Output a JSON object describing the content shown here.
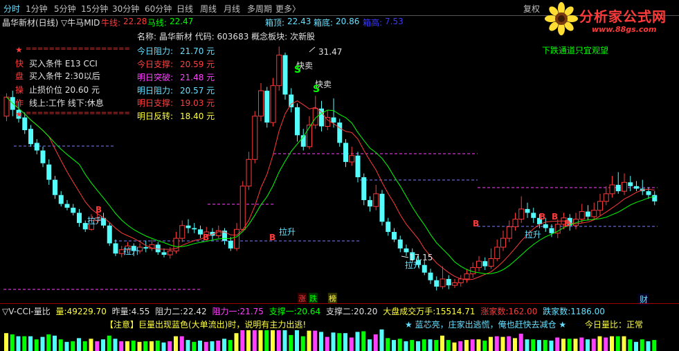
{
  "toolbar": {
    "tabs": [
      "分时",
      "1分钟",
      "5分钟",
      "15分钟",
      "30分钟",
      "60分钟",
      "日线",
      "周线",
      "月线",
      "多周期",
      "更多〉"
    ],
    "active": "分时",
    "fuquan": "复权"
  },
  "logo": {
    "title": "分析家公式网",
    "url": "www.88gs.com"
  },
  "info": {
    "stock": "晶华新材(日线)",
    "indicator": "▽牛马MID",
    "niu_label": "牛线:",
    "niu_value": "22.28",
    "ma_label": "马线:",
    "ma_value": "22.47",
    "xiangding_label": "箱顶:",
    "xiangding_value": "22.43",
    "xiangdi_label": "箱底:",
    "xiangdi_value": "20.86",
    "qiang_label": "箱高:",
    "qiang_value": "7.53"
  },
  "panel_left": {
    "rows": [
      {
        "mark": "★",
        "text": "=================="
      },
      {
        "mark": "快",
        "text": "买入条件    E13 CCI"
      },
      {
        "mark": "盘",
        "text": "买入条件    2:30以后"
      },
      {
        "mark": "操",
        "text": "止损价位    20.60 元"
      },
      {
        "mark": "作",
        "text": "线上:工作   线下:休息"
      },
      {
        "mark": "★",
        "text": "=================="
      }
    ]
  },
  "panel_right": {
    "title": "名称: 晶华新材 代码: 603683  概念板块: 次新股",
    "rows": [
      {
        "label": "今日阻力:",
        "value": "21.70 元",
        "color": "#66e0ff"
      },
      {
        "label": "今日支撑:",
        "value": "20.59 元",
        "color": "#ff4040"
      },
      {
        "label": "明日突破:",
        "value": "21.48 元",
        "color": "#ff40ff"
      },
      {
        "label": "明日阻力:",
        "value": "20.57 元",
        "color": "#66e0ff"
      },
      {
        "label": "明日支撑:",
        "value": "19.03 元",
        "color": "#ff4040"
      },
      {
        "label": "明日反转:",
        "value": "18.40 元",
        "color": "#ffff40"
      }
    ]
  },
  "chart_annotations": {
    "top_right_note": "下跌通道只宜观望",
    "high_label": "31.47",
    "low_label": "17.15",
    "sell_labels": [
      "快卖",
      "快卖"
    ],
    "sell_marks": [
      "S",
      "S"
    ],
    "buy_labels": [
      "拉升",
      "拉升",
      "拉升",
      "拉升",
      "拉升"
    ],
    "b_marks": [
      "B",
      "B",
      "B",
      "B",
      "B",
      "B",
      "B"
    ],
    "bottom_marks": [
      "涨",
      "跌",
      "榜"
    ],
    "cai": "财"
  },
  "sub_info": {
    "name": "▽V-CCI-量比",
    "liang_label": "量:",
    "liang_value": "49229.70",
    "zuoliang_label": "昨量:",
    "zuoliang_value": "4.55",
    "zuli2_label": "阻力二:",
    "zuli2_value": "22.42",
    "zuli1_label": "阻力一:",
    "zuli1_value": "21.75",
    "zhicheng1_label": "支撑一:",
    "zhicheng1_value": "20.64",
    "zhicheng2_label": "支撑二:",
    "zhicheng2_value": "20.20",
    "dapan_label": "大盘成交万手:",
    "dapan_value": "15514.71",
    "zhangjia_label": "涨家数:",
    "zhangjia_value": "162.00",
    "diejia_label": "跌家数:",
    "diejia_value": "1186.00",
    "notice": "【注意】巨量出现蓝色(大单流出)时，说明有主力出逃!",
    "notice2": "★ 蓝芯亮，庄家出逃慌，俺也赶快去减仓 ★",
    "liangbi_label": "今日量比：",
    "liangbi_value": "正常"
  },
  "colors": {
    "up": "#ff3a3a",
    "down": "#54fcfc",
    "green": "#00ff00",
    "magenta": "#ff40ff",
    "yellow": "#ffff40",
    "red": "#ff3a3a"
  },
  "chart_data": {
    "type": "candlestick",
    "high": 31.47,
    "low": 17.15,
    "candles": [
      [
        26.0,
        27.5,
        27.8,
        25.6
      ],
      [
        27.5,
        26.5,
        28.0,
        26.0
      ],
      [
        26.5,
        25.8,
        27.2,
        25.5
      ],
      [
        25.9,
        24.9,
        26.3,
        24.6
      ],
      [
        25.0,
        23.8,
        25.3,
        23.6
      ],
      [
        23.9,
        23.3,
        24.2,
        23.0
      ],
      [
        23.3,
        22.3,
        23.6,
        22.0
      ],
      [
        22.2,
        21.0,
        22.6,
        20.6
      ],
      [
        21.0,
        19.8,
        21.3,
        19.5
      ],
      [
        19.8,
        19.1,
        20.1,
        18.9
      ],
      [
        19.1,
        18.8,
        19.4,
        18.6
      ],
      [
        18.8,
        18.4,
        19.1,
        18.2
      ],
      [
        18.4,
        17.6,
        18.7,
        17.3
      ],
      [
        17.6,
        17.1,
        17.8,
        16.9
      ],
      [
        17.1,
        17.8,
        18.3,
        17.0
      ],
      [
        17.8,
        18.0,
        18.5,
        17.6
      ],
      [
        18.0,
        17.4,
        18.4,
        17.2
      ],
      [
        17.4,
        16.0,
        17.6,
        15.8
      ],
      [
        16.0,
        15.2,
        16.3,
        15.0
      ],
      [
        15.2,
        15.5,
        15.8,
        14.9
      ],
      [
        15.5,
        15.8,
        16.1,
        15.2
      ],
      [
        15.8,
        15.4,
        16.0,
        15.0
      ],
      [
        15.4,
        15.7,
        16.0,
        15.2
      ],
      [
        15.7,
        15.6,
        16.2,
        15.3
      ],
      [
        15.6,
        15.9,
        16.3,
        15.4
      ],
      [
        15.9,
        15.3,
        16.1,
        15.1
      ],
      [
        15.3,
        15.1,
        15.6,
        14.9
      ],
      [
        15.1,
        15.4,
        15.7,
        14.8
      ],
      [
        15.4,
        16.4,
        16.9,
        15.2
      ],
      [
        16.4,
        17.4,
        17.8,
        16.1
      ],
      [
        17.4,
        17.2,
        17.9,
        16.8
      ],
      [
        17.2,
        17.1,
        17.6,
        16.8
      ],
      [
        17.1,
        16.7,
        17.4,
        16.4
      ],
      [
        16.7,
        16.9,
        17.3,
        16.5
      ],
      [
        16.9,
        16.6,
        17.2,
        16.3
      ],
      [
        16.6,
        17.0,
        17.4,
        16.4
      ],
      [
        17.0,
        16.2,
        17.2,
        15.9
      ],
      [
        16.2,
        15.6,
        16.5,
        15.4
      ],
      [
        15.6,
        17.1,
        17.6,
        15.4
      ],
      [
        17.1,
        20.5,
        20.9,
        17.0
      ],
      [
        20.5,
        22.6,
        23.2,
        20.2
      ],
      [
        22.6,
        26.0,
        26.4,
        22.3
      ],
      [
        26.0,
        28.0,
        28.6,
        25.6
      ],
      [
        28.0,
        25.5,
        28.3,
        25.1
      ],
      [
        25.5,
        28.4,
        29.0,
        25.2
      ],
      [
        28.4,
        30.8,
        31.47,
        28.0
      ],
      [
        30.8,
        27.7,
        31.0,
        27.3
      ],
      [
        27.7,
        26.7,
        28.2,
        26.3
      ],
      [
        26.7,
        24.5,
        27.0,
        24.0
      ],
      [
        24.5,
        23.6,
        25.0,
        23.3
      ],
      [
        23.6,
        25.3,
        26.0,
        23.4
      ],
      [
        25.3,
        26.6,
        27.6,
        25.0
      ],
      [
        26.6,
        25.2,
        27.2,
        24.8
      ],
      [
        25.2,
        25.9,
        26.5,
        24.9
      ],
      [
        25.9,
        25.5,
        27.4,
        25.1
      ],
      [
        25.5,
        23.9,
        25.8,
        23.6
      ],
      [
        23.9,
        22.4,
        24.2,
        22.0
      ],
      [
        22.4,
        22.9,
        23.6,
        22.1
      ],
      [
        22.9,
        21.2,
        23.2,
        20.8
      ],
      [
        21.2,
        19.4,
        21.5,
        19.0
      ],
      [
        19.4,
        18.9,
        19.7,
        18.5
      ],
      [
        18.9,
        19.9,
        20.6,
        18.6
      ],
      [
        19.9,
        17.7,
        20.2,
        17.4
      ],
      [
        17.7,
        16.9,
        18.0,
        16.6
      ],
      [
        16.9,
        16.3,
        17.2,
        16.1
      ],
      [
        16.3,
        15.6,
        16.6,
        15.3
      ],
      [
        15.6,
        15.3,
        15.9,
        15.0
      ],
      [
        15.3,
        14.7,
        15.6,
        14.5
      ],
      [
        14.7,
        14.3,
        15.0,
        14.1
      ],
      [
        14.3,
        13.7,
        14.7,
        13.5
      ],
      [
        13.7,
        13.1,
        14.0,
        12.8
      ],
      [
        13.1,
        12.6,
        13.4,
        12.3
      ],
      [
        12.6,
        13.2,
        14.2,
        12.4
      ],
      [
        13.2,
        12.7,
        13.5,
        12.4
      ],
      [
        12.7,
        12.9,
        13.2,
        12.5
      ],
      [
        12.9,
        13.2,
        13.5,
        12.6
      ],
      [
        13.2,
        13.6,
        14.0,
        12.9
      ],
      [
        13.6,
        14.1,
        14.5,
        13.3
      ],
      [
        14.1,
        14.6,
        15.0,
        13.8
      ],
      [
        14.6,
        14.2,
        14.9,
        13.9
      ],
      [
        14.2,
        14.8,
        15.6,
        14.0
      ],
      [
        14.8,
        15.7,
        16.3,
        14.6
      ],
      [
        15.7,
        16.4,
        17.0,
        15.4
      ],
      [
        16.4,
        17.3,
        17.8,
        16.1
      ],
      [
        17.3,
        17.9,
        18.4,
        17.0
      ],
      [
        17.9,
        18.7,
        19.7,
        17.6
      ],
      [
        18.7,
        18.4,
        19.2,
        18.0
      ],
      [
        18.4,
        18.0,
        18.8,
        17.6
      ],
      [
        18.0,
        17.5,
        18.3,
        17.2
      ],
      [
        17.5,
        17.2,
        18.0,
        16.9
      ],
      [
        17.2,
        16.8,
        17.5,
        16.5
      ],
      [
        16.8,
        17.5,
        17.9,
        16.4
      ],
      [
        17.5,
        18.0,
        18.4,
        17.1
      ],
      [
        18.0,
        17.4,
        18.3,
        17.0
      ],
      [
        17.4,
        17.9,
        18.4,
        17.1
      ],
      [
        17.9,
        18.5,
        19.1,
        17.6
      ],
      [
        18.5,
        18.1,
        19.0,
        17.8
      ],
      [
        18.1,
        18.6,
        19.2,
        17.9
      ],
      [
        18.6,
        19.3,
        19.9,
        18.2
      ],
      [
        19.3,
        19.9,
        20.5,
        19.0
      ],
      [
        19.9,
        20.6,
        21.3,
        19.6
      ],
      [
        20.6,
        20.1,
        21.6,
        19.9
      ],
      [
        20.1,
        20.8,
        21.5,
        19.8
      ],
      [
        20.8,
        20.5,
        21.3,
        20.1
      ],
      [
        20.5,
        20.3,
        20.9,
        20.1
      ],
      [
        20.3,
        20.1,
        21.0,
        19.8
      ],
      [
        20.1,
        19.8,
        20.4,
        19.5
      ],
      [
        19.8,
        19.3,
        20.1,
        19.0
      ]
    ]
  }
}
